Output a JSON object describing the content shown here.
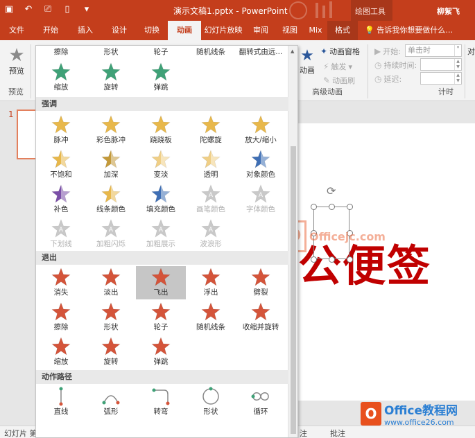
{
  "window": {
    "doc_title": "演示文稿1.pptx - PowerPoint",
    "tool_title": "绘图工具",
    "user": "柳絮飞"
  },
  "tabs": [
    {
      "label": "文件",
      "w": 48
    },
    {
      "label": "开始",
      "w": 50
    },
    {
      "label": "插入",
      "w": 50
    },
    {
      "label": "设计",
      "w": 48
    },
    {
      "label": "切换",
      "w": 46
    },
    {
      "label": "动画",
      "w": 48,
      "active": true
    },
    {
      "label": "幻灯片放映",
      "w": 64
    },
    {
      "label": "审阅",
      "w": 44
    },
    {
      "label": "视图",
      "w": 40
    },
    {
      "label": "Mix",
      "w": 34
    },
    {
      "label": "格式",
      "w": 44,
      "context": true
    }
  ],
  "tell_me": "告诉我你想要做什么…",
  "ribbon": {
    "preview_label": "预览",
    "preview_group": "预览",
    "add_animation": "动画",
    "animation_pane": "动画窗格",
    "trigger": "触发",
    "anim_painter": "动画刷",
    "advanced_group": "高级动画",
    "start_label": "开始:",
    "start_value": "单击时",
    "duration_label": "持续时间:",
    "delay_label": "延迟:",
    "timing_group": "计时",
    "reorder_label": "对"
  },
  "gallery": {
    "top_row": [
      "擦除",
      "形状",
      "轮子",
      "随机线条",
      "翻转式由远..."
    ],
    "entrance_tail": [
      "缩放",
      "旋转",
      "弹跳"
    ],
    "emphasis_title": "强调",
    "emphasis": [
      [
        "脉冲",
        "彩色脉冲",
        "跷跷板",
        "陀螺旋",
        "放大/缩小"
      ],
      [
        "不饱和",
        "加深",
        "变淡",
        "透明",
        "对象颜色"
      ],
      [
        "补色",
        "线条颜色",
        "填充颜色",
        "画笔颜色",
        "字体颜色"
      ],
      [
        "下划线",
        "加粗闪烁",
        "加粗展示",
        "波浪形"
      ]
    ],
    "exit_title": "退出",
    "exit": [
      [
        "消失",
        "淡出",
        "飞出",
        "浮出",
        "劈裂"
      ],
      [
        "擦除",
        "形状",
        "轮子",
        "随机线条",
        "收缩并旋转"
      ],
      [
        "缩放",
        "旋转",
        "弹跳"
      ]
    ],
    "paths_title": "动作路径",
    "paths": [
      "直线",
      "弧形",
      "转弯",
      "形状",
      "循环"
    ]
  },
  "slide": {
    "number": "1",
    "text": "公便签"
  },
  "status": {
    "left": "幻灯片 第",
    "notes": "注",
    "comments": "批注"
  },
  "watermark": {
    "brand": "Office教程网",
    "url": "www.office26.com",
    "mid": "Officejc.com",
    "logo_char": "O"
  },
  "colors": {
    "accent": "#c43e1c",
    "emphasis_gold": "#e8b84b",
    "emphasis_purple": "#7b4fa8",
    "emphasis_blue": "#3f6fb5",
    "exit_red": "#d4543a",
    "entrance_green": "#3fa177",
    "disabled_gray": "#c9c9c9"
  }
}
